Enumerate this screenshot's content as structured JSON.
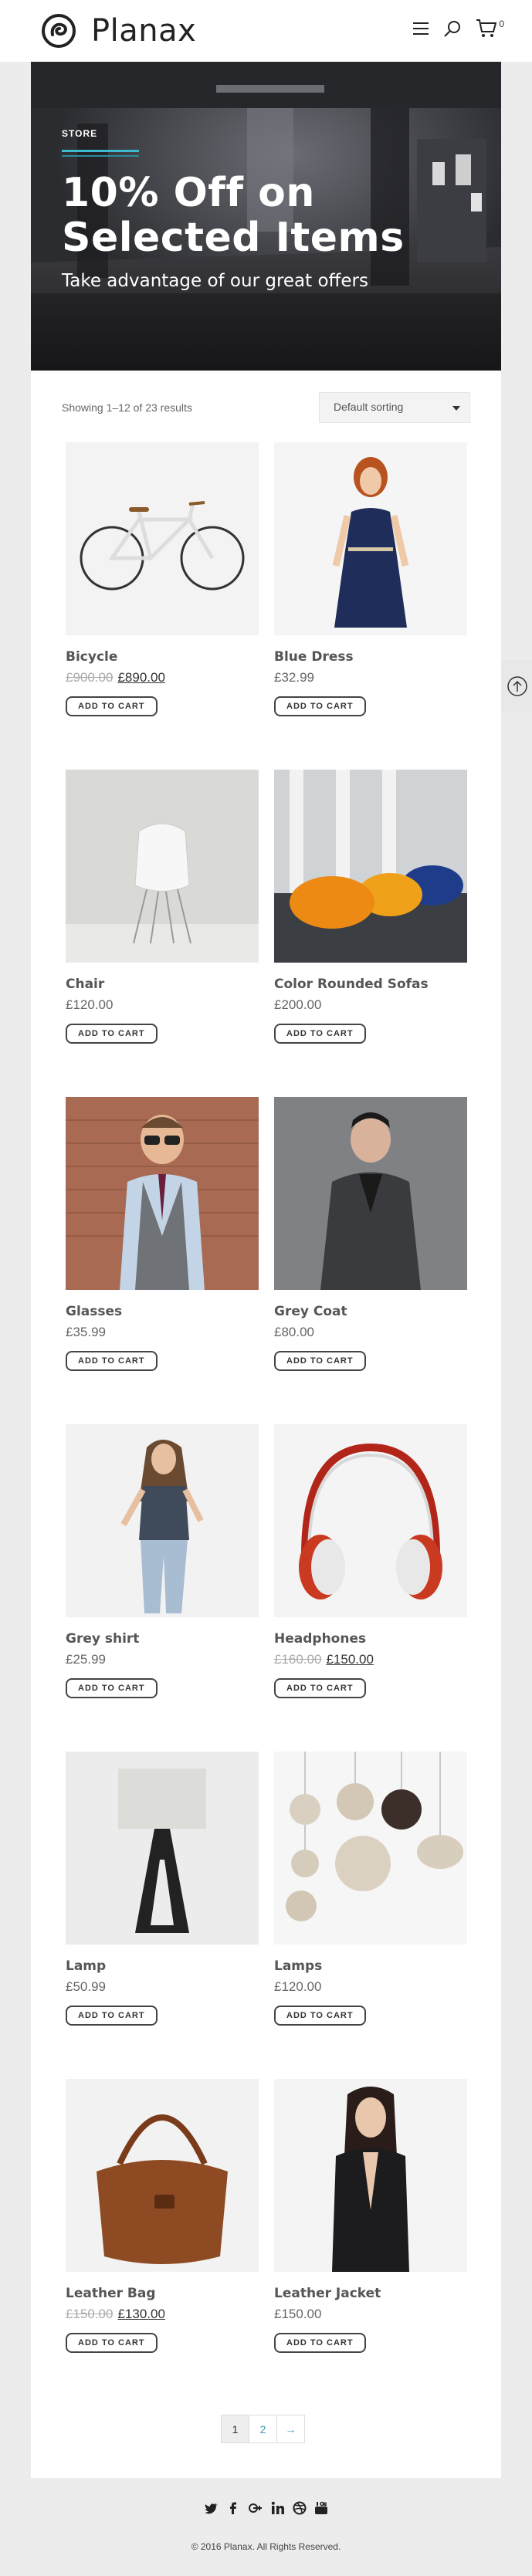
{
  "header": {
    "logo_text": "Planax",
    "cart_count": "0"
  },
  "hero": {
    "eyebrow": "STORE",
    "title_line1": "10% Off on",
    "title_line2": "Selected Items",
    "subtitle": "Take advantage of our great offers"
  },
  "toolbar": {
    "results_text": "Showing 1–12 of 23 results",
    "sort_value": "Default sorting"
  },
  "products": [
    {
      "name": "Bicycle",
      "old_price": "£900.00",
      "price": "£890.00",
      "cta": "ADD TO CART"
    },
    {
      "name": "Blue Dress",
      "old_price": "",
      "price": "£32.99",
      "cta": "ADD TO CART"
    },
    {
      "name": "Chair",
      "old_price": "",
      "price": "£120.00",
      "cta": "ADD TO CART"
    },
    {
      "name": "Color Rounded Sofas",
      "old_price": "",
      "price": "£200.00",
      "cta": "ADD TO CART"
    },
    {
      "name": "Glasses",
      "old_price": "",
      "price": "£35.99",
      "cta": "ADD TO CART"
    },
    {
      "name": "Grey Coat",
      "old_price": "",
      "price": "£80.00",
      "cta": "ADD TO CART"
    },
    {
      "name": "Grey shirt",
      "old_price": "",
      "price": "£25.99",
      "cta": "ADD TO CART"
    },
    {
      "name": "Headphones",
      "old_price": "£160.00",
      "price": "£150.00",
      "cta": "ADD TO CART"
    },
    {
      "name": "Lamp",
      "old_price": "",
      "price": "£50.99",
      "cta": "ADD TO CART"
    },
    {
      "name": "Lamps",
      "old_price": "",
      "price": "£120.00",
      "cta": "ADD TO CART"
    },
    {
      "name": "Leather Bag",
      "old_price": "£150.00",
      "price": "£130.00",
      "cta": "ADD TO CART"
    },
    {
      "name": "Leather Jacket",
      "old_price": "",
      "price": "£150.00",
      "cta": "ADD TO CART"
    }
  ],
  "pagination": {
    "page1": "1",
    "page2": "2",
    "next": "→"
  },
  "footer": {
    "social_icons": [
      "twitter-icon",
      "facebook-icon",
      "google-plus-icon",
      "linkedin-icon",
      "dribbble-icon",
      "youtube-icon"
    ],
    "copyright": "© 2016 Planax. All Rights Reserved."
  },
  "colors": {
    "accent": "#3dbcd0",
    "text": "#555555",
    "footer_bg": "#ececec"
  }
}
